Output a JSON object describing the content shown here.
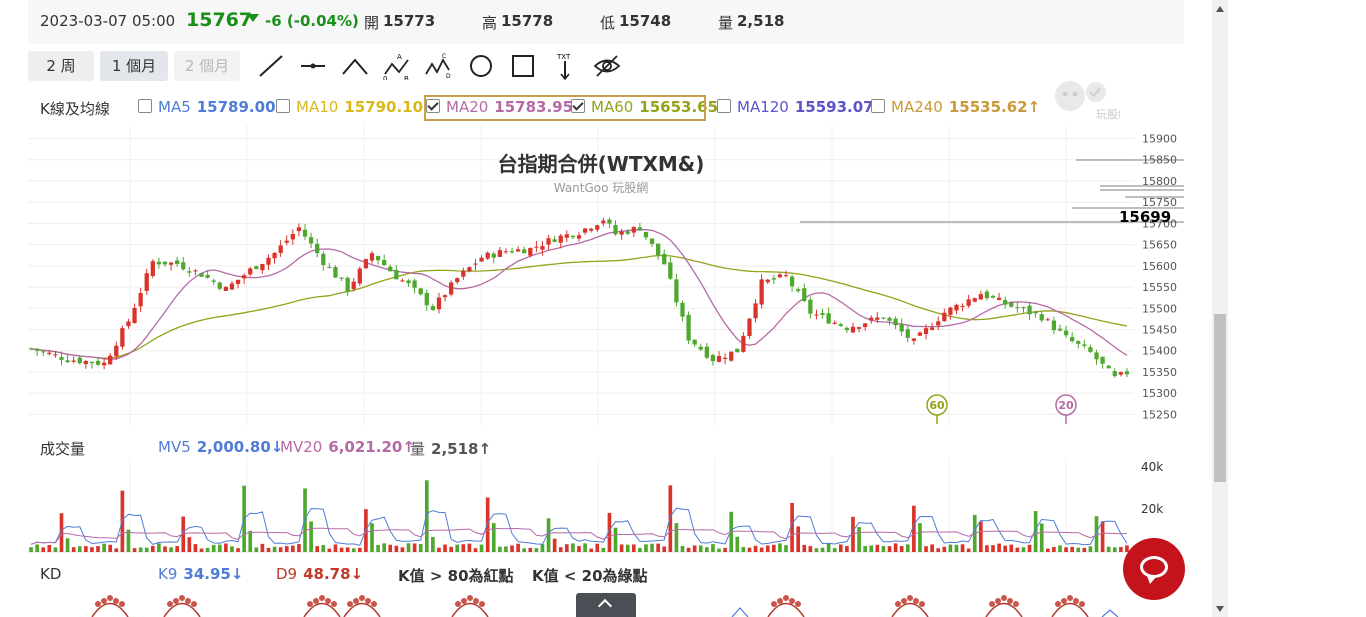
{
  "quote": {
    "datetime": "2023-03-07 05:00",
    "last": "15767",
    "change": "-6 (-0.04%)",
    "open_label": "開",
    "open": "15773",
    "high_label": "高",
    "high": "15778",
    "low_label": "低",
    "low": "15748",
    "vol_label": "量",
    "vol": "2,518",
    "colors": {
      "down": "#1a8f1a"
    }
  },
  "toolbar": {
    "ranges": [
      "2 周",
      "1 個月",
      "2 個月"
    ],
    "active_range": "1 個月",
    "disabled_range": "2 個月",
    "tools": [
      "line-tool-icon",
      "horizontal-line-icon",
      "polyline-icon",
      "abcd-pattern-icon",
      "abcde-pattern-icon",
      "circle-icon",
      "rectangle-icon",
      "text-arrow-icon",
      "hide-eye-icon"
    ],
    "tool_letters": {
      "a": "A",
      "b": "B",
      "c": "C",
      "d": "D",
      "zero": "0",
      "txt": "TXT"
    }
  },
  "ma_legend": {
    "title": "K線及均線",
    "items": [
      {
        "name": "MA5",
        "value": "15789.00↓",
        "checked": false,
        "color": "#4f7cd6"
      },
      {
        "name": "MA10",
        "value": "15790.10↓",
        "checked": false,
        "color": "#d7b91e"
      },
      {
        "name": "MA20",
        "value": "15783.95↑",
        "checked": true,
        "color": "#b56aa6"
      },
      {
        "name": "MA60",
        "value": "15653.65↑",
        "checked": true,
        "color": "#93a31a"
      },
      {
        "name": "MA120",
        "value": "15593.07↑",
        "checked": false,
        "color": "#5b55c9"
      },
      {
        "name": "MA240",
        "value": "15535.62↑",
        "checked": false,
        "color": "#c79a3a"
      }
    ],
    "highlight_color": "#c8a24a"
  },
  "chart_title": "台指期合併(WTXM&)",
  "chart_subtitle": "WantGoo 玩股網",
  "logo_text": "玩股網",
  "chart_data": [
    {
      "type": "candlestick",
      "title": "台指期合併(WTXM&)",
      "y_axis_ticks": [
        15250,
        15300,
        15350,
        15400,
        15450,
        15500,
        15550,
        15600,
        15650,
        15700,
        15750,
        15800,
        15850,
        15900
      ],
      "ylim": [
        15225,
        15920
      ],
      "n_bars": 181,
      "close_path": [
        [
          0,
          15405
        ],
        [
          6,
          15380
        ],
        [
          12,
          15370
        ],
        [
          16,
          15470
        ],
        [
          20,
          15610
        ],
        [
          24,
          15605
        ],
        [
          28,
          15580
        ],
        [
          32,
          15545
        ],
        [
          36,
          15590
        ],
        [
          40,
          15630
        ],
        [
          44,
          15690
        ],
        [
          48,
          15610
        ],
        [
          52,
          15545
        ],
        [
          56,
          15630
        ],
        [
          60,
          15575
        ],
        [
          62,
          15555
        ],
        [
          66,
          15500
        ],
        [
          70,
          15570
        ],
        [
          74,
          15620
        ],
        [
          78,
          15635
        ],
        [
          82,
          15640
        ],
        [
          86,
          15665
        ],
        [
          90,
          15680
        ],
        [
          94,
          15710
        ],
        [
          96,
          15675
        ],
        [
          100,
          15690
        ],
        [
          104,
          15605
        ],
        [
          108,
          15430
        ],
        [
          112,
          15380
        ],
        [
          116,
          15400
        ],
        [
          120,
          15560
        ],
        [
          124,
          15575
        ],
        [
          128,
          15490
        ],
        [
          134,
          15455
        ],
        [
          140,
          15480
        ],
        [
          145,
          15420
        ],
        [
          150,
          15490
        ],
        [
          156,
          15535
        ],
        [
          160,
          15510
        ],
        [
          166,
          15480
        ],
        [
          170,
          15430
        ],
        [
          174,
          15395
        ],
        [
          178,
          15335
        ],
        [
          181,
          15355
        ]
      ],
      "series": [
        {
          "name": "MA20",
          "color": "#b56aa6"
        },
        {
          "name": "MA60",
          "color": "#93a31a"
        }
      ],
      "annotations": {
        "marks": [
          "15834",
          "15783",
          "15774",
          "15767",
          "15748",
          "15730",
          "15699"
        ],
        "badges": [
          "60",
          "20"
        ]
      },
      "grid": true
    },
    {
      "type": "bar",
      "title": "成交量",
      "y_axis_ticks": [
        "40k",
        "20k"
      ],
      "legend": [
        {
          "name": "MV5",
          "value": "2,000.80↓",
          "color": "#4f7cd6"
        },
        {
          "name": "MV20",
          "value": "6,021.20↑",
          "color": "#b56aa6"
        },
        {
          "name": "量",
          "value": "2,518↑",
          "color": "#555"
        }
      ]
    },
    {
      "type": "line",
      "title": "KD",
      "legend": [
        {
          "name": "K9",
          "value": "34.95↓",
          "color": "#4f7cd6"
        },
        {
          "name": "D9",
          "value": "48.78↓",
          "color": "#c0392b"
        }
      ],
      "notes": [
        "K值 > 80為紅點",
        "K值 < 20為綠點"
      ]
    }
  ]
}
